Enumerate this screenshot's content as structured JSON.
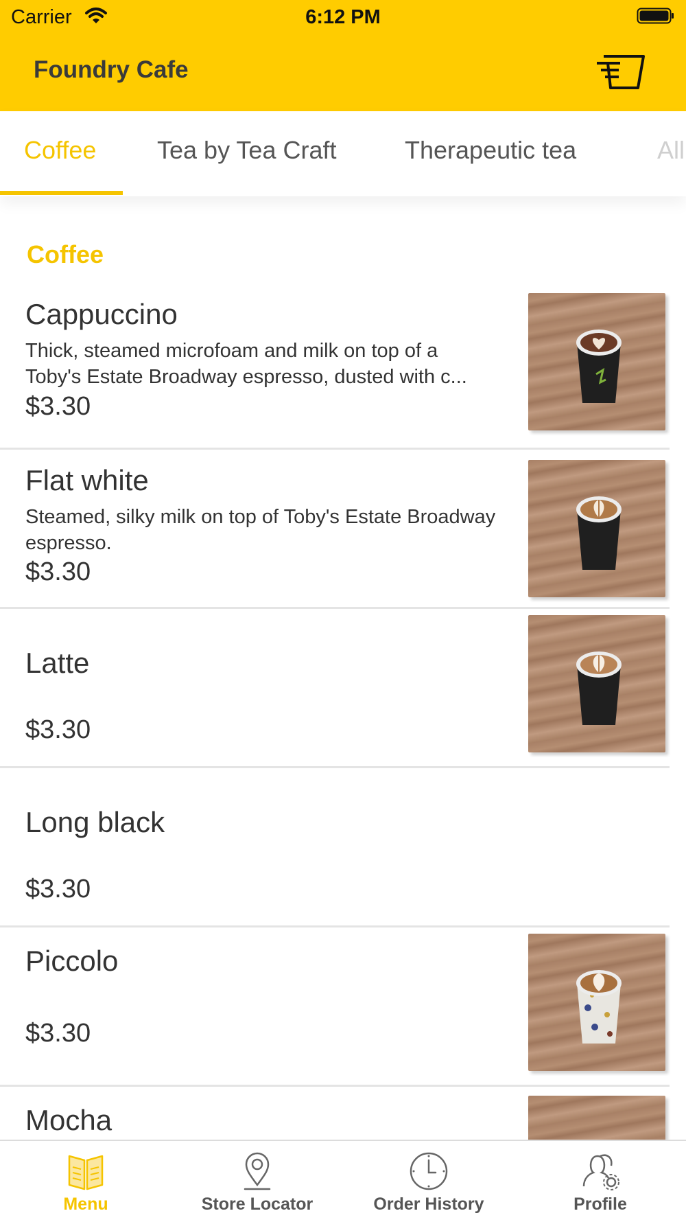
{
  "status_bar": {
    "carrier": "Carrier",
    "time": "6:12 PM"
  },
  "header": {
    "title": "Foundry Cafe",
    "cart_icon": "cart-icon"
  },
  "tabs": [
    {
      "label": "Coffee",
      "active": true
    },
    {
      "label": "Tea by Tea Craft",
      "active": false
    },
    {
      "label": "Therapeutic tea",
      "active": false
    },
    {
      "label": "All",
      "active": false
    }
  ],
  "section": {
    "title": "Coffee"
  },
  "items": [
    {
      "name": "Cappuccino",
      "description": "Thick, steamed microfoam and milk on top of a Toby's Estate Broadway espresso, dusted with c...",
      "price": "$3.30",
      "has_image": true
    },
    {
      "name": "Flat white",
      "description": "Steamed, silky milk on top of Toby's Estate Broadway espresso.",
      "price": "$3.30",
      "has_image": true
    },
    {
      "name": "Latte",
      "description": "",
      "price": "$3.30",
      "has_image": true
    },
    {
      "name": "Long black",
      "description": "",
      "price": "$3.30",
      "has_image": false
    },
    {
      "name": "Piccolo",
      "description": "",
      "price": "$3.30",
      "has_image": true
    },
    {
      "name": "Mocha",
      "description": "",
      "price": "",
      "has_image": true
    }
  ],
  "tab_bar": [
    {
      "label": "Menu",
      "icon": "menu-book-icon",
      "active": true
    },
    {
      "label": "Store Locator",
      "icon": "map-pin-icon",
      "active": false
    },
    {
      "label": "Order History",
      "icon": "clock-icon",
      "active": false
    },
    {
      "label": "Profile",
      "icon": "profile-icon",
      "active": false
    }
  ],
  "colors": {
    "accent": "#FFCC00",
    "accent_text": "#F5C400",
    "text": "#333333",
    "divider": "#e4e4e4"
  }
}
